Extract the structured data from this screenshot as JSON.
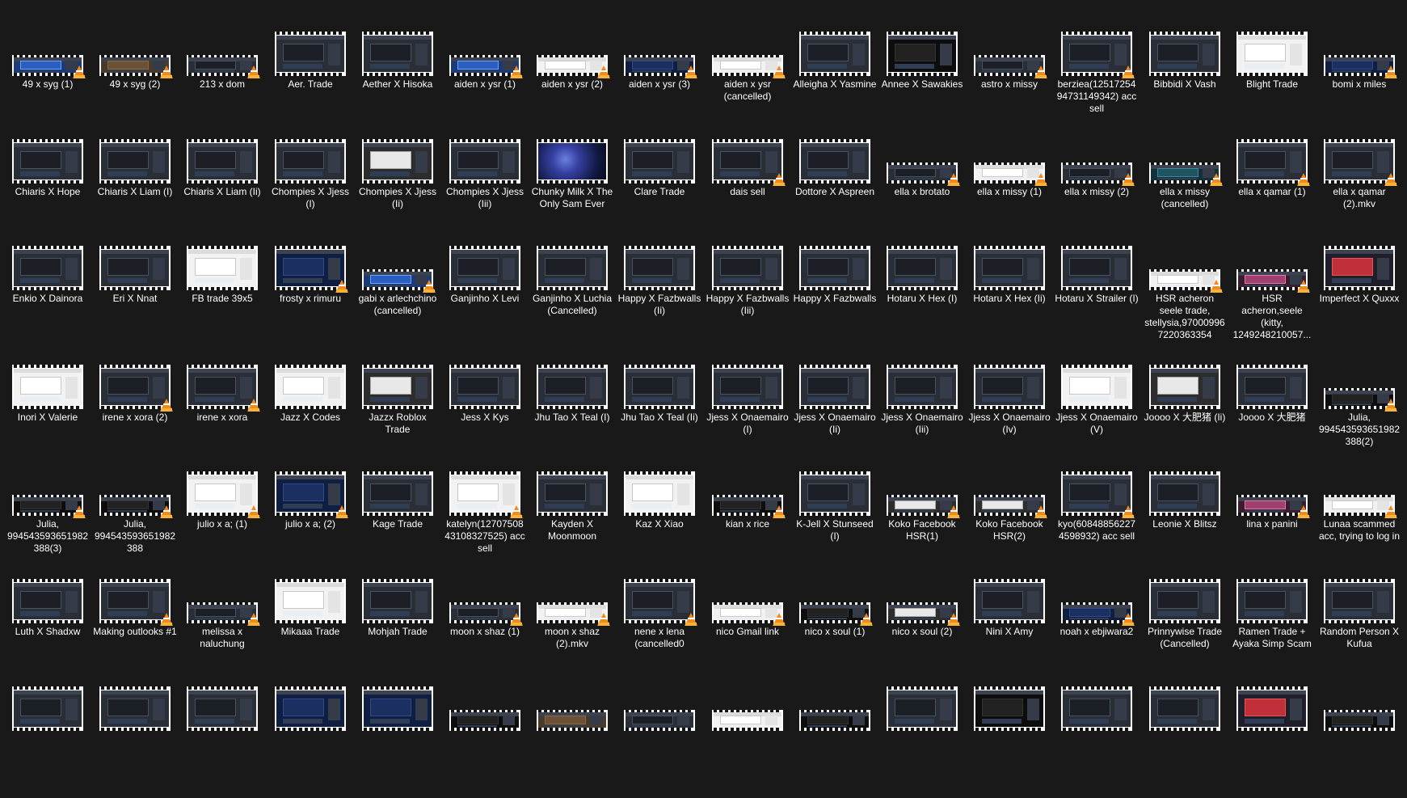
{
  "explorer": {
    "items": [
      {
        "name": "49 x syg (1)",
        "kind": "short",
        "style": "blue",
        "vlc": true
      },
      {
        "name": "49 x syg (2)",
        "kind": "short",
        "style": "brown",
        "vlc": true
      },
      {
        "name": "213 x dom",
        "kind": "short",
        "style": "default",
        "vlc": true
      },
      {
        "name": "Aer. Trade",
        "kind": "tall",
        "style": "default",
        "vlc": false
      },
      {
        "name": "Aether X Hisoka",
        "kind": "tall",
        "style": "default",
        "vlc": false
      },
      {
        "name": "aiden x ysr (1)",
        "kind": "short",
        "style": "blue",
        "vlc": true
      },
      {
        "name": "aiden x ysr (2)",
        "kind": "short",
        "style": "white",
        "vlc": true
      },
      {
        "name": "aiden x ysr (3)",
        "kind": "short",
        "style": "navy",
        "vlc": true
      },
      {
        "name": "aiden x ysr (cancelled)",
        "kind": "short",
        "style": "white",
        "vlc": true
      },
      {
        "name": "Alleigha X Yasmine",
        "kind": "tall",
        "style": "default",
        "vlc": false
      },
      {
        "name": "Annee X Sawakies",
        "kind": "tall",
        "style": "dark",
        "vlc": false
      },
      {
        "name": "astro x missy",
        "kind": "short",
        "style": "default",
        "vlc": true
      },
      {
        "name": "berziea(12517254 94731149342) acc sell",
        "kind": "tall",
        "style": "default",
        "vlc": true
      },
      {
        "name": "Bibbidi X Vash",
        "kind": "tall",
        "style": "default",
        "vlc": false
      },
      {
        "name": "Blight Trade",
        "kind": "tall",
        "style": "white",
        "vlc": false
      },
      {
        "name": "bomi x miles",
        "kind": "short",
        "style": "navy",
        "vlc": true
      },
      {
        "name": "Chiaris X Hope",
        "kind": "tall",
        "style": "default",
        "vlc": false
      },
      {
        "name": "Chiaris X Liam (I)",
        "kind": "tall",
        "style": "default",
        "vlc": false
      },
      {
        "name": "Chiaris X Liam (Ii)",
        "kind": "tall",
        "style": "default",
        "vlc": false
      },
      {
        "name": "Chompies X Jjess (I)",
        "kind": "tall",
        "style": "default",
        "vlc": false
      },
      {
        "name": "Chompies X Jjess (Ii)",
        "kind": "tall",
        "style": "mixed",
        "vlc": false
      },
      {
        "name": "Chompies X Jjess (Iii)",
        "kind": "tall",
        "style": "default",
        "vlc": false
      },
      {
        "name": "Chunky Milk X The Only Sam Ever",
        "kind": "tall",
        "style": "space",
        "vlc": false
      },
      {
        "name": "Clare Trade",
        "kind": "tall",
        "style": "default",
        "vlc": false
      },
      {
        "name": "dais sell",
        "kind": "tall",
        "style": "default",
        "vlc": true
      },
      {
        "name": "Dottore X Aspreen",
        "kind": "tall",
        "style": "default",
        "vlc": false
      },
      {
        "name": "ella x brotato",
        "kind": "short",
        "style": "default",
        "vlc": true
      },
      {
        "name": "ella x missy (1)",
        "kind": "short",
        "style": "white",
        "vlc": true
      },
      {
        "name": "ella x missy (2)",
        "kind": "short",
        "style": "default",
        "vlc": true
      },
      {
        "name": "ella x missy (cancelled)",
        "kind": "short",
        "style": "teal",
        "vlc": true
      },
      {
        "name": "ella x qamar (1)",
        "kind": "tall",
        "style": "default",
        "vlc": true
      },
      {
        "name": "ella x qamar (2).mkv",
        "kind": "tall",
        "style": "default",
        "vlc": true
      },
      {
        "name": "Enkio X Dainora",
        "kind": "tall",
        "style": "default",
        "vlc": false
      },
      {
        "name": "Eri X Nnat",
        "kind": "tall",
        "style": "default",
        "vlc": false
      },
      {
        "name": "FB trade 39x5",
        "kind": "tall",
        "style": "white",
        "vlc": false
      },
      {
        "name": "frosty x rimuru",
        "kind": "tall",
        "style": "navy",
        "vlc": true
      },
      {
        "name": "gabi x arlechchino (cancelled)",
        "kind": "short",
        "style": "blue",
        "vlc": true
      },
      {
        "name": "Ganjinho X Levi",
        "kind": "tall",
        "style": "default",
        "vlc": false
      },
      {
        "name": "Ganjinho X Luchia (Cancelled)",
        "kind": "tall",
        "style": "default",
        "vlc": false
      },
      {
        "name": "Happy X Fazbwalls  (Ii)",
        "kind": "tall",
        "style": "default",
        "vlc": false
      },
      {
        "name": "Happy X Fazbwalls (Iii)",
        "kind": "tall",
        "style": "default",
        "vlc": false
      },
      {
        "name": "Happy X Fazbwalls",
        "kind": "tall",
        "style": "default",
        "vlc": false
      },
      {
        "name": "Hotaru X Hex (I)",
        "kind": "tall",
        "style": "default",
        "vlc": false
      },
      {
        "name": "Hotaru X Hex (Ii)",
        "kind": "tall",
        "style": "default",
        "vlc": false
      },
      {
        "name": "Hotaru X Strailer (I)",
        "kind": "tall",
        "style": "default",
        "vlc": false
      },
      {
        "name": "HSR acheron seele trade, stellysia,97000996 7220363354",
        "kind": "short",
        "style": "white",
        "vlc": true
      },
      {
        "name": "HSR acheron,seele (kitty, 1249248210057...",
        "kind": "short",
        "style": "pink",
        "vlc": true
      },
      {
        "name": "Imperfect X Quxxx",
        "kind": "tall",
        "style": "red",
        "vlc": false
      },
      {
        "name": "Inori X Valerie",
        "kind": "tall",
        "style": "white",
        "vlc": false
      },
      {
        "name": "irene x xora (2)",
        "kind": "tall",
        "style": "default",
        "vlc": true
      },
      {
        "name": "irene x xora",
        "kind": "tall",
        "style": "default",
        "vlc": true
      },
      {
        "name": "Jazz X Codes",
        "kind": "tall",
        "style": "white",
        "vlc": false
      },
      {
        "name": "Jazzx Roblox Trade",
        "kind": "tall",
        "style": "mixed",
        "vlc": false
      },
      {
        "name": "Jess X Kys",
        "kind": "tall",
        "style": "default",
        "vlc": false
      },
      {
        "name": "Jhu Tao X Teal (I)",
        "kind": "tall",
        "style": "default",
        "vlc": false
      },
      {
        "name": "Jhu Tao X Teal (Ii)",
        "kind": "tall",
        "style": "default",
        "vlc": false
      },
      {
        "name": "Jjess X Onaemairo (I)",
        "kind": "tall",
        "style": "default",
        "vlc": false
      },
      {
        "name": "Jjess X Onaemairo (Ii)",
        "kind": "tall",
        "style": "default",
        "vlc": false
      },
      {
        "name": "Jjess X Onaemairo (Iii)",
        "kind": "tall",
        "style": "default",
        "vlc": false
      },
      {
        "name": "Jjess X Onaemairo (Iv)",
        "kind": "tall",
        "style": "default",
        "vlc": false
      },
      {
        "name": "Jjess X Onaemairo (V)",
        "kind": "tall",
        "style": "white",
        "vlc": false
      },
      {
        "name": "Joooo X 大肥猪 (Ii)",
        "kind": "tall",
        "style": "mixed",
        "vlc": false
      },
      {
        "name": "Joooo X 大肥猪",
        "kind": "tall",
        "style": "default",
        "vlc": false
      },
      {
        "name": "Julia, 994543593651982 388(2)",
        "kind": "short",
        "style": "dark",
        "vlc": true
      },
      {
        "name": "Julia, 994543593651982 388(3)",
        "kind": "short",
        "style": "dark",
        "vlc": true
      },
      {
        "name": "Julia, 994543593651982 388",
        "kind": "short",
        "style": "dark",
        "vlc": true
      },
      {
        "name": "julio x a; (1)",
        "kind": "tall",
        "style": "white",
        "vlc": true
      },
      {
        "name": "julio x a; (2)",
        "kind": "tall",
        "style": "navy",
        "vlc": true
      },
      {
        "name": "Kage Trade",
        "kind": "tall",
        "style": "default",
        "vlc": false
      },
      {
        "name": "katelyn(12707508 43108327525) acc sell",
        "kind": "tall",
        "style": "white",
        "vlc": true
      },
      {
        "name": "Kayden X Moonmoon",
        "kind": "tall",
        "style": "default",
        "vlc": false
      },
      {
        "name": "Kaz X Xiao",
        "kind": "tall",
        "style": "white",
        "vlc": false
      },
      {
        "name": "kian x rice",
        "kind": "short",
        "style": "dark",
        "vlc": true
      },
      {
        "name": "K-Jell X Stunseed (I)",
        "kind": "tall",
        "style": "default",
        "vlc": false
      },
      {
        "name": "Koko Facebook HSR(1)",
        "kind": "short",
        "style": "mixed",
        "vlc": true
      },
      {
        "name": "Koko Facebook HSR(2)",
        "kind": "short",
        "style": "mixed",
        "vlc": true
      },
      {
        "name": "kyo(60848856227 4598932) acc sell",
        "kind": "tall",
        "style": "default",
        "vlc": true
      },
      {
        "name": "Leonie X Blitsz",
        "kind": "tall",
        "style": "default",
        "vlc": false
      },
      {
        "name": "lina x panini",
        "kind": "short",
        "style": "pink",
        "vlc": true
      },
      {
        "name": "Lunaa scammed acc, trying to log in",
        "kind": "short",
        "style": "white",
        "vlc": true
      },
      {
        "name": "Luth X Shadxw",
        "kind": "tall",
        "style": "default",
        "vlc": false
      },
      {
        "name": "Making outlooks #1",
        "kind": "tall",
        "style": "default",
        "vlc": true
      },
      {
        "name": "melissa x naluchung",
        "kind": "short",
        "style": "default",
        "vlc": true
      },
      {
        "name": "Mikaaa Trade",
        "kind": "tall",
        "style": "white",
        "vlc": false
      },
      {
        "name": "Mohjah Trade",
        "kind": "tall",
        "style": "default",
        "vlc": false
      },
      {
        "name": "moon x shaz (1)",
        "kind": "short",
        "style": "default",
        "vlc": true
      },
      {
        "name": "moon x shaz (2).mkv",
        "kind": "short",
        "style": "white",
        "vlc": true
      },
      {
        "name": "nene x lena (cancelled0",
        "kind": "tall",
        "style": "default",
        "vlc": true
      },
      {
        "name": "nico Gmail link",
        "kind": "short",
        "style": "white",
        "vlc": true
      },
      {
        "name": "nico x soul (1)",
        "kind": "short",
        "style": "dark",
        "vlc": true
      },
      {
        "name": "nico x soul (2)",
        "kind": "short",
        "style": "mixed",
        "vlc": true
      },
      {
        "name": "Nini X Amy",
        "kind": "tall",
        "style": "default",
        "vlc": false
      },
      {
        "name": "noah x ebjiwara2",
        "kind": "short",
        "style": "navy",
        "vlc": true
      },
      {
        "name": "Prinnywise Trade (Cancelled)",
        "kind": "tall",
        "style": "default",
        "vlc": false
      },
      {
        "name": "Ramen Trade + Ayaka Simp Scam",
        "kind": "tall",
        "style": "default",
        "vlc": false
      },
      {
        "name": "Random Person X Kufua",
        "kind": "tall",
        "style": "default",
        "vlc": false
      },
      {
        "name": "",
        "kind": "tall",
        "style": "default",
        "vlc": false
      },
      {
        "name": "",
        "kind": "tall",
        "style": "default",
        "vlc": false
      },
      {
        "name": "",
        "kind": "tall",
        "style": "default",
        "vlc": false
      },
      {
        "name": "",
        "kind": "tall",
        "style": "navy",
        "vlc": false
      },
      {
        "name": "",
        "kind": "tall",
        "style": "navy",
        "vlc": false
      },
      {
        "name": "",
        "kind": "short",
        "style": "dark",
        "vlc": false
      },
      {
        "name": "",
        "kind": "short",
        "style": "brown",
        "vlc": false
      },
      {
        "name": "",
        "kind": "short",
        "style": "default",
        "vlc": false
      },
      {
        "name": "",
        "kind": "short",
        "style": "white",
        "vlc": false
      },
      {
        "name": "",
        "kind": "short",
        "style": "dark",
        "vlc": false
      },
      {
        "name": "",
        "kind": "tall",
        "style": "default",
        "vlc": false
      },
      {
        "name": "",
        "kind": "tall",
        "style": "dark",
        "vlc": false
      },
      {
        "name": "",
        "kind": "tall",
        "style": "default",
        "vlc": false
      },
      {
        "name": "",
        "kind": "tall",
        "style": "default",
        "vlc": false
      },
      {
        "name": "",
        "kind": "tall",
        "style": "red",
        "vlc": false
      },
      {
        "name": "",
        "kind": "short",
        "style": "dark",
        "vlc": false
      }
    ]
  }
}
